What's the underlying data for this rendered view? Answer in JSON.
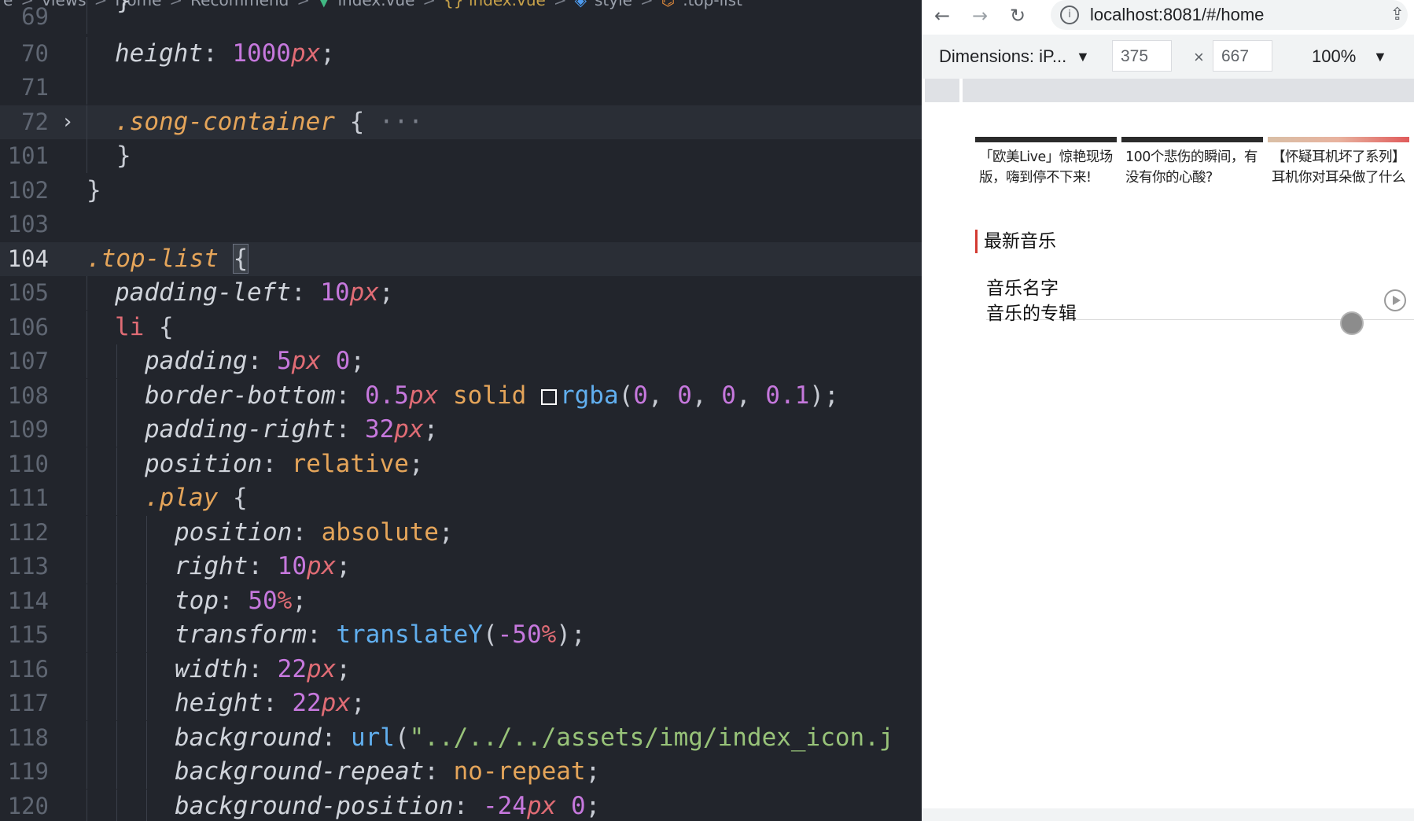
{
  "breadcrumb": {
    "items": [
      "e",
      "views",
      "Home",
      "Recommend",
      "index.vue",
      "{} index.vue",
      "style",
      ".top-list"
    ],
    "separator": ">"
  },
  "editor": {
    "lines": [
      {
        "num": "69",
        "text": "}"
      },
      {
        "num": "70",
        "text": "height: 1000px;"
      },
      {
        "num": "71",
        "text": ""
      },
      {
        "num": "72",
        "text": ".song-container { ···"
      },
      {
        "num": "101",
        "text": "}"
      },
      {
        "num": "102",
        "text": "}"
      },
      {
        "num": "103",
        "text": ""
      },
      {
        "num": "104",
        "text": ".top-list {"
      },
      {
        "num": "105",
        "text": "padding-left: 10px;"
      },
      {
        "num": "106",
        "text": "li {"
      },
      {
        "num": "107",
        "text": "padding: 5px 0;"
      },
      {
        "num": "108",
        "text": "border-bottom: 0.5px solid rgba(0, 0, 0, 0.1);"
      },
      {
        "num": "109",
        "text": "padding-right: 32px;"
      },
      {
        "num": "110",
        "text": "position: relative;"
      },
      {
        "num": "111",
        "text": ".play {"
      },
      {
        "num": "112",
        "text": "position: absolute;"
      },
      {
        "num": "113",
        "text": "right: 10px;"
      },
      {
        "num": "114",
        "text": "top: 50%;"
      },
      {
        "num": "115",
        "text": "transform: translateY(-50%);"
      },
      {
        "num": "116",
        "text": "width: 22px;"
      },
      {
        "num": "117",
        "text": "height: 22px;"
      },
      {
        "num": "118",
        "text": "background: url(\"../../../assets/img/index_icon.j"
      },
      {
        "num": "119",
        "text": "background-repeat: no-repeat;"
      },
      {
        "num": "120",
        "text": "background-position: -24px 0;"
      }
    ],
    "fold_icon": "chevron-right-icon",
    "color_swatch": "#ffffff"
  },
  "browser": {
    "nav": {
      "back_icon": "arrow-left-icon",
      "forward_icon": "arrow-right-icon",
      "reload_icon": "reload-icon"
    },
    "url": "localhost:8081/#/home",
    "device_toolbar": {
      "dimensions_label": "Dimensions: iP...",
      "width": "375",
      "height": "667",
      "times": "×",
      "zoom": "100%"
    },
    "page": {
      "playlists": [
        {
          "title": "「欧美Live」惊艳现场版，嗨到停不下来!"
        },
        {
          "title": "100个悲伤的瞬间，有没有你的心酸?"
        },
        {
          "title": "【怀疑耳机坏了系列】耳机你对耳朵做了什么"
        }
      ],
      "section_title": "最新音乐",
      "songs": [
        {
          "name": "音乐名字",
          "album": "音乐的专辑"
        }
      ],
      "accent_color": "#d33a31"
    }
  }
}
